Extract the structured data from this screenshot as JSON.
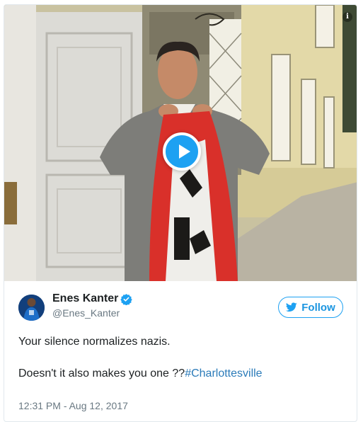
{
  "media": {
    "type": "video",
    "play_icon": "play-icon",
    "info_icon": "info-icon",
    "info_glyph": "i"
  },
  "author": {
    "name": "Enes Kanter",
    "handle": "@Enes_Kanter",
    "verified_icon": "verified-badge-icon"
  },
  "follow": {
    "label": "Follow",
    "icon": "twitter-bird-icon"
  },
  "tweet": {
    "line1": "Your silence normalizes nazis.",
    "line2_text": "Doesn't it also makes you one ??",
    "line2_hashtag": "#Charlottesville",
    "timestamp": "12:31 PM - Aug 12, 2017"
  },
  "colors": {
    "accent": "#1da1f2",
    "link": "#2b7bb9",
    "secondary_text": "#697882",
    "border": "#e1e8ed"
  }
}
